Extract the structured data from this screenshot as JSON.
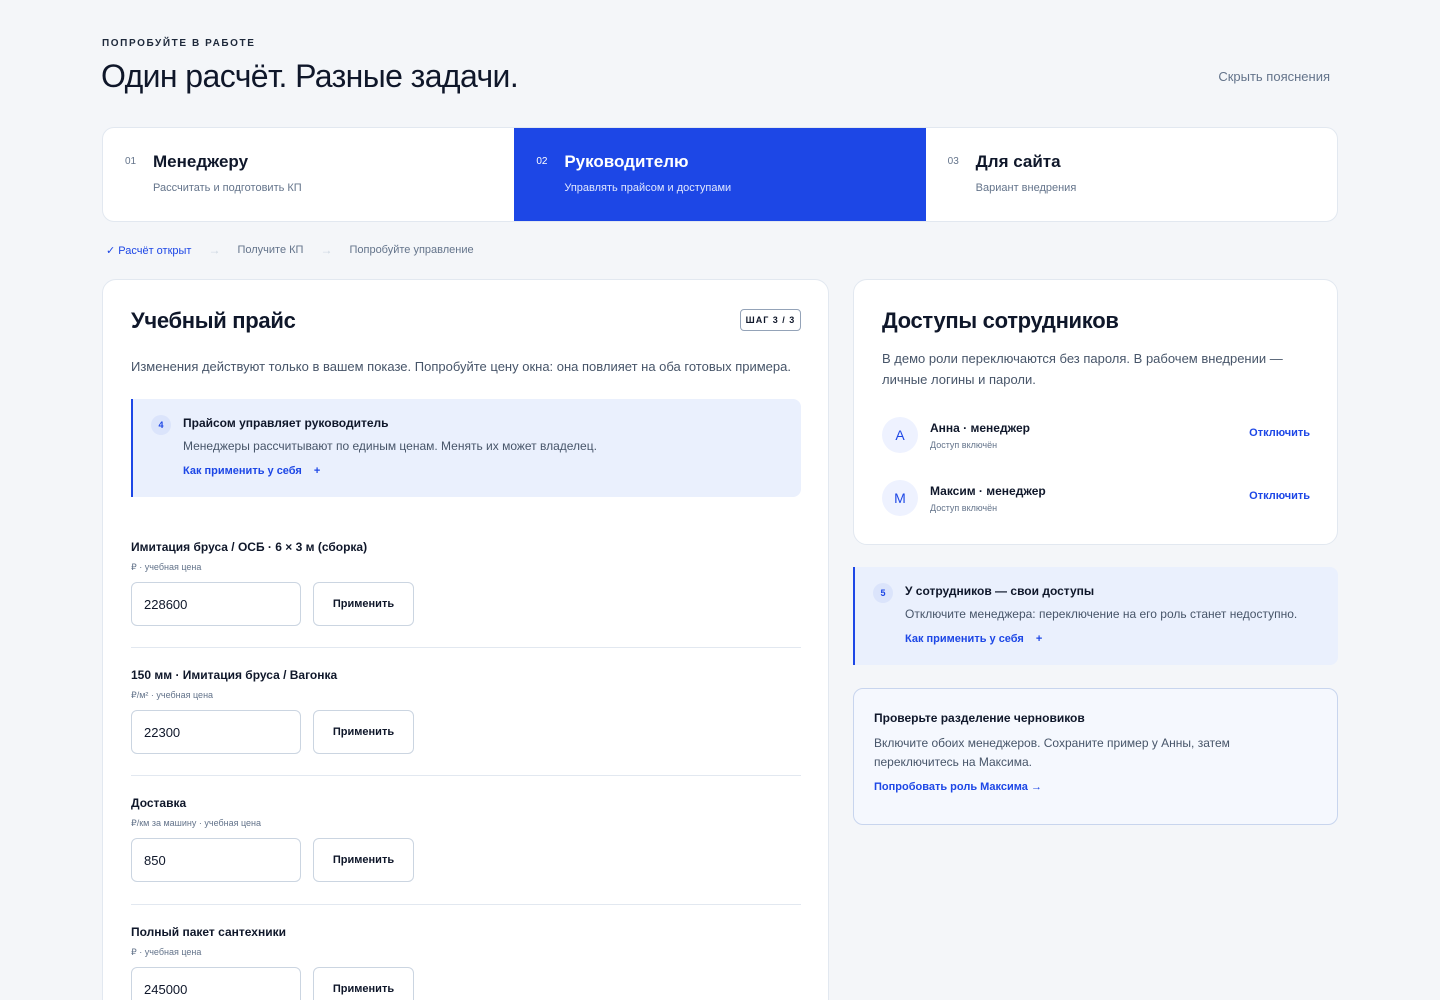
{
  "header": {
    "eyebrow": "ПОПРОБУЙТЕ В РАБОТЕ",
    "title": "Один расчёт. Разные задачи.",
    "hide_link": "Скрыть пояснения"
  },
  "tabs": [
    {
      "num": "01",
      "title": "Менеджеру",
      "subtitle": "Рассчитать и подготовить КП",
      "active": false
    },
    {
      "num": "02",
      "title": "Руководителю",
      "subtitle": "Управлять прайсом и доступами",
      "active": true
    },
    {
      "num": "03",
      "title": "Для сайта",
      "subtitle": "Вариант внедрения",
      "active": false
    }
  ],
  "progress": {
    "step1": "✓ Расчёт открыт",
    "arrow": "→",
    "step2": "Получите КП",
    "step3": "Попробуйте управление"
  },
  "price_card": {
    "title": "Учебный прайс",
    "badge": "ШАГ 3 / 3",
    "lead": "Изменения действуют только в вашем показе. Попробуйте цену окна: она повлияет на оба готовых примера.",
    "hint": {
      "number": "4",
      "title": "Прайсом управляет руководитель",
      "text": "Менеджеры рассчитывают по единым ценам. Менять их может владелец.",
      "link": "Как применить у себя",
      "plus": "+"
    },
    "apply_label": "Применить",
    "rows": [
      {
        "title": "Имитация бруса / ОСБ · 6 × 3 м (сборка)",
        "unit": "₽ · учебная цена",
        "value": "228600"
      },
      {
        "title": "150 мм · Имитация бруса / Вагонка",
        "unit": "₽/м² · учебная цена",
        "value": "22300"
      },
      {
        "title": "Доставка",
        "unit": "₽/км за машину · учебная цена",
        "value": "850"
      },
      {
        "title": "Полный пакет сантехники",
        "unit": "₽ · учебная цена",
        "value": "245000"
      }
    ]
  },
  "access_card": {
    "title": "Доступы сотрудников",
    "lead_line1": "В демо роли переключаются без пароля. В рабочем внедрении —",
    "lead_line2": "личные логины и пароли.",
    "disable_label": "Отключить",
    "people": [
      {
        "initial": "А",
        "name": "Анна · менеджер",
        "status": "Доступ включён"
      },
      {
        "initial": "М",
        "name": "Максим · менеджер",
        "status": "Доступ включён"
      }
    ]
  },
  "staff_hint": {
    "number": "5",
    "title": "У сотрудников — свои доступы",
    "text": "Отключите менеджера: переключение на его роль станет недоступно.",
    "link": "Как применить у себя",
    "plus": "+"
  },
  "drafts_card": {
    "title": "Проверьте разделение черновиков",
    "text_line1": "Включите обоих менеджеров. Сохраните пример у Анны, затем",
    "text_line2": "переключитесь на Максима.",
    "link": "Попробовать роль Максима →"
  },
  "colors": {
    "accent": "#1d47e6",
    "background": "#f4f6f9",
    "hint_background": "#eaf0fd"
  }
}
